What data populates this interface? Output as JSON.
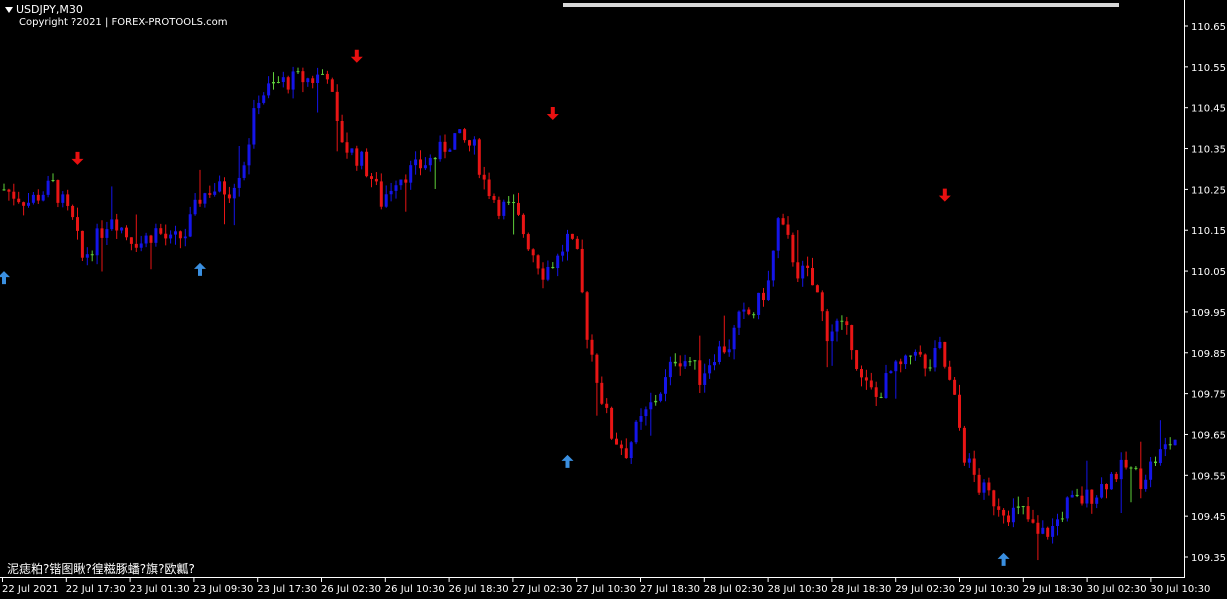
{
  "window": {
    "symbol_label": "USDJPY,M30",
    "copyright": "Copyright ?2021 | FOREX-PROTOOLS.com",
    "footer_text": "泥痣粕?锴图瞅?徨糍豚蟠?旗?欧瓤?"
  },
  "colors": {
    "background": "#000000",
    "bull": "#1515e8",
    "bear": "#e81515",
    "doji": "#5ecf3a",
    "buy_arrow": "#3a8fe0",
    "sell_arrow": "#e81010",
    "axis": "#ffffff"
  },
  "icons": {
    "header": "triangle-down-icon",
    "buy": "arrow-up-icon",
    "sell": "arrow-down-icon"
  },
  "chart_data": {
    "type": "candlestick",
    "ylim": [
      109.3,
      110.7
    ],
    "y_ticks": [
      "110.65",
      "110.55",
      "110.45",
      "110.35",
      "110.25",
      "110.15",
      "110.05",
      "109.95",
      "109.85",
      "109.75",
      "109.65",
      "109.55",
      "109.45",
      "109.35"
    ],
    "x_ticks": [
      "22 Jul 2021",
      "22 Jul 17:30",
      "23 Jul 01:30",
      "23 Jul 09:30",
      "23 Jul 17:30",
      "26 Jul 02:30",
      "26 Jul 10:30",
      "26 Jul 18:30",
      "27 Jul 02:30",
      "27 Jul 10:30",
      "27 Jul 18:30",
      "28 Jul 02:30",
      "28 Jul 10:30",
      "28 Jul 18:30",
      "29 Jul 02:30",
      "29 Jul 10:30",
      "29 Jul 18:30",
      "30 Jul 02:30",
      "30 Jul 10:30"
    ],
    "close_path": [
      [
        0,
        110.25
      ],
      [
        5,
        110.22
      ],
      [
        10,
        110.26
      ],
      [
        14,
        110.17
      ],
      [
        16,
        110.08
      ],
      [
        19,
        110.13
      ],
      [
        22,
        110.19
      ],
      [
        25,
        110.14
      ],
      [
        28,
        110.12
      ],
      [
        31,
        110.15
      ],
      [
        34,
        110.12
      ],
      [
        37,
        110.14
      ],
      [
        40,
        110.23
      ],
      [
        42,
        110.25
      ],
      [
        46,
        110.25
      ],
      [
        49,
        110.32
      ],
      [
        52,
        110.48
      ],
      [
        56,
        110.51
      ],
      [
        60,
        110.52
      ],
      [
        63,
        110.52
      ],
      [
        66,
        110.54
      ],
      [
        68,
        110.4
      ],
      [
        70,
        110.35
      ],
      [
        73,
        110.32
      ],
      [
        75,
        110.28
      ],
      [
        77,
        110.22
      ],
      [
        80,
        110.28
      ],
      [
        84,
        110.3
      ],
      [
        88,
        110.33
      ],
      [
        92,
        110.38
      ],
      [
        96,
        110.35
      ],
      [
        98,
        110.27
      ],
      [
        101,
        110.21
      ],
      [
        104,
        110.2
      ],
      [
        107,
        110.12
      ],
      [
        110,
        110.05
      ],
      [
        113,
        110.08
      ],
      [
        115,
        110.13
      ],
      [
        117,
        110.08
      ],
      [
        119,
        109.9
      ],
      [
        122,
        109.74
      ],
      [
        124,
        109.65
      ],
      [
        127,
        109.61
      ],
      [
        129,
        109.66
      ],
      [
        132,
        109.72
      ],
      [
        135,
        109.78
      ],
      [
        137,
        109.84
      ],
      [
        140,
        109.83
      ],
      [
        142,
        109.79
      ],
      [
        145,
        109.85
      ],
      [
        148,
        109.87
      ],
      [
        150,
        109.93
      ],
      [
        153,
        109.95
      ],
      [
        156,
        110.02
      ],
      [
        158,
        110.17
      ],
      [
        160,
        110.12
      ],
      [
        162,
        110.05
      ],
      [
        164,
        110.04
      ],
      [
        166,
        109.99
      ],
      [
        168,
        109.9
      ],
      [
        170,
        109.92
      ],
      [
        173,
        109.88
      ],
      [
        175,
        109.78
      ],
      [
        178,
        109.74
      ],
      [
        181,
        109.8
      ],
      [
        184,
        109.82
      ],
      [
        186,
        109.87
      ],
      [
        188,
        109.8
      ],
      [
        191,
        109.86
      ],
      [
        194,
        109.73
      ],
      [
        196,
        109.6
      ],
      [
        199,
        109.52
      ],
      [
        202,
        109.49
      ],
      [
        205,
        109.46
      ],
      [
        208,
        109.46
      ],
      [
        211,
        109.4
      ],
      [
        214,
        109.42
      ],
      [
        217,
        109.48
      ],
      [
        220,
        109.49
      ],
      [
        223,
        109.51
      ],
      [
        226,
        109.55
      ],
      [
        229,
        109.57
      ],
      [
        232,
        109.54
      ],
      [
        235,
        109.59
      ],
      [
        238,
        109.63
      ],
      [
        240,
        109.65
      ]
    ],
    "buy_signals": [
      [
        0,
        110.05
      ],
      [
        40,
        110.07
      ],
      [
        115,
        109.6
      ],
      [
        204,
        109.36
      ]
    ],
    "sell_signals": [
      [
        15,
        110.31
      ],
      [
        72,
        110.56
      ],
      [
        112,
        110.42
      ],
      [
        192,
        110.22
      ]
    ]
  }
}
